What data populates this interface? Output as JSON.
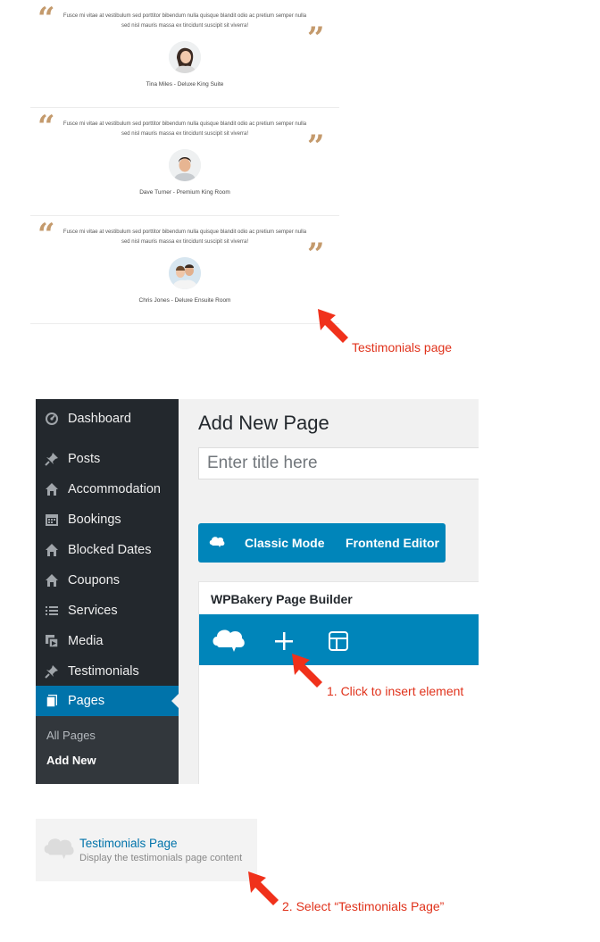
{
  "testimonials": [
    {
      "text": "Fusce mi vitae at vestibulum sed porttitor bibendum nulla quisque blandit odio ac pretium semper nulla sed nisl mauris massa ex tincidunt suscipit sit viverra!",
      "author": "Tina Miles - Deluxe King Suite",
      "avatar": "woman-avatar"
    },
    {
      "text": "Fusce mi vitae at vestibulum sed porttitor bibendum nulla quisque blandit odio ac pretium semper nulla sed nisl mauris massa ex tincidunt suscipit sit viverra!",
      "author": "Dave Turner - Premium King Room",
      "avatar": "man-avatar"
    },
    {
      "text": "Fusce mi vitae at vestibulum sed porttitor bibendum nulla quisque blandit odio ac pretium semper nulla sed nisl mauris massa ex tincidunt suscipit sit viverra!",
      "author": "Chris Jones - Deluxe Ensuite Room",
      "avatar": "couple-avatar"
    }
  ],
  "quote_open_glyph": "“",
  "quote_close_glyph": "”",
  "annotations": {
    "testimonials_page": "Testimonials page",
    "step1": "1. Click to insert element",
    "step2": "2. Select “Testimonials Page”"
  },
  "sidebar": {
    "items": [
      {
        "label": "Dashboard",
        "icon": "dashboard-icon"
      },
      {
        "label": "Posts",
        "icon": "pin-icon"
      },
      {
        "label": "Accommodation",
        "icon": "home-icon"
      },
      {
        "label": "Bookings",
        "icon": "calendar-icon"
      },
      {
        "label": "Blocked Dates",
        "icon": "home-icon"
      },
      {
        "label": "Coupons",
        "icon": "home-icon"
      },
      {
        "label": "Services",
        "icon": "list-icon"
      },
      {
        "label": "Media",
        "icon": "media-icon"
      },
      {
        "label": "Testimonials",
        "icon": "pin-icon"
      },
      {
        "label": "Pages",
        "icon": "pages-icon",
        "active": true
      }
    ],
    "submenu": [
      {
        "label": "All Pages"
      },
      {
        "label": "Add New",
        "current": true
      }
    ]
  },
  "editor": {
    "page_title": "Add New Page",
    "title_placeholder": "Enter title here",
    "classic_mode_label": "Classic Mode",
    "frontend_editor_label": "Frontend Editor",
    "builder_title": "WPBakery Page Builder"
  },
  "element": {
    "title": "Testimonials Page",
    "description": "Display the testimonials page content",
    "icon": "wpbakery-cloud-icon"
  },
  "colors": {
    "quote": "#c49a6c",
    "annotation": "#e0321b",
    "wp_blue": "#0085ba",
    "sidebar_bg": "#23282d",
    "active_menu": "#0073aa"
  }
}
